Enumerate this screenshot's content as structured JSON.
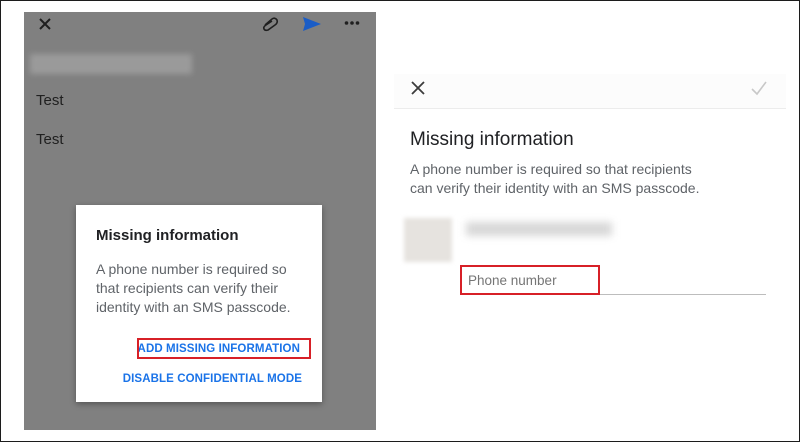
{
  "left_panel": {
    "toolbar": {
      "close_icon": "close-icon",
      "attach_icon": "paperclip-icon",
      "send_icon": "send-icon",
      "more_icon": "more-horizontal-icon"
    },
    "body_lines": [
      "Test",
      "Test"
    ],
    "dialog": {
      "title": "Missing information",
      "message": "A phone number is required so that recipients can verify their identity with an SMS passcode.",
      "add_button": "ADD MISSING INFORMATION",
      "disable_button": "DISABLE CONFIDENTIAL MODE"
    }
  },
  "right_panel": {
    "header": {
      "close_icon": "close-icon",
      "check_icon": "check-icon"
    },
    "title": "Missing information",
    "message": "A phone number is required so that recipients can verify their identity with an SMS passcode.",
    "phone_input": {
      "placeholder": "Phone number",
      "value": ""
    }
  },
  "colors": {
    "accent_blue": "#1a73e8",
    "highlight_red": "#d72027",
    "overlay_gray": "#808080"
  }
}
